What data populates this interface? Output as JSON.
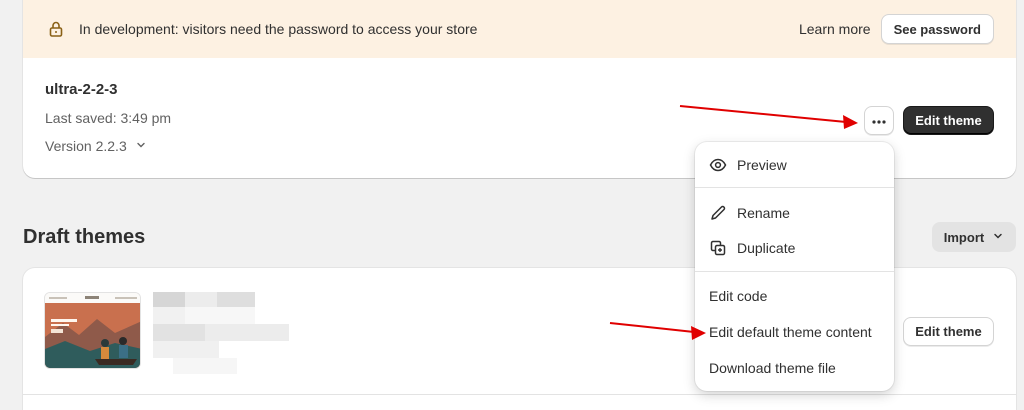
{
  "banner": {
    "message": "In development: visitors need the password to access your store",
    "learn_more": "Learn more",
    "see_password": "See password",
    "icon": "lock-icon"
  },
  "live_theme": {
    "name": "ultra-2-2-3",
    "last_saved": "Last saved: 3:49 pm",
    "version": "Version 2.2.3",
    "edit_theme": "Edit theme",
    "more_icon": "ellipsis-icon"
  },
  "drafts": {
    "title": "Draft themes",
    "import": "Import",
    "edit_theme": "Edit theme"
  },
  "menu": {
    "items": [
      {
        "label": "Preview",
        "icon": "eye-icon"
      },
      {
        "label": "Rename",
        "icon": "pencil-icon"
      },
      {
        "label": "Duplicate",
        "icon": "duplicate-icon"
      },
      {
        "label": "Edit code"
      },
      {
        "label": "Edit default theme content"
      },
      {
        "label": "Download theme file"
      }
    ]
  },
  "colors": {
    "banner_bg": "#fdf1e2",
    "primary_button": "#303030",
    "annotation_arrow": "#e00000"
  }
}
